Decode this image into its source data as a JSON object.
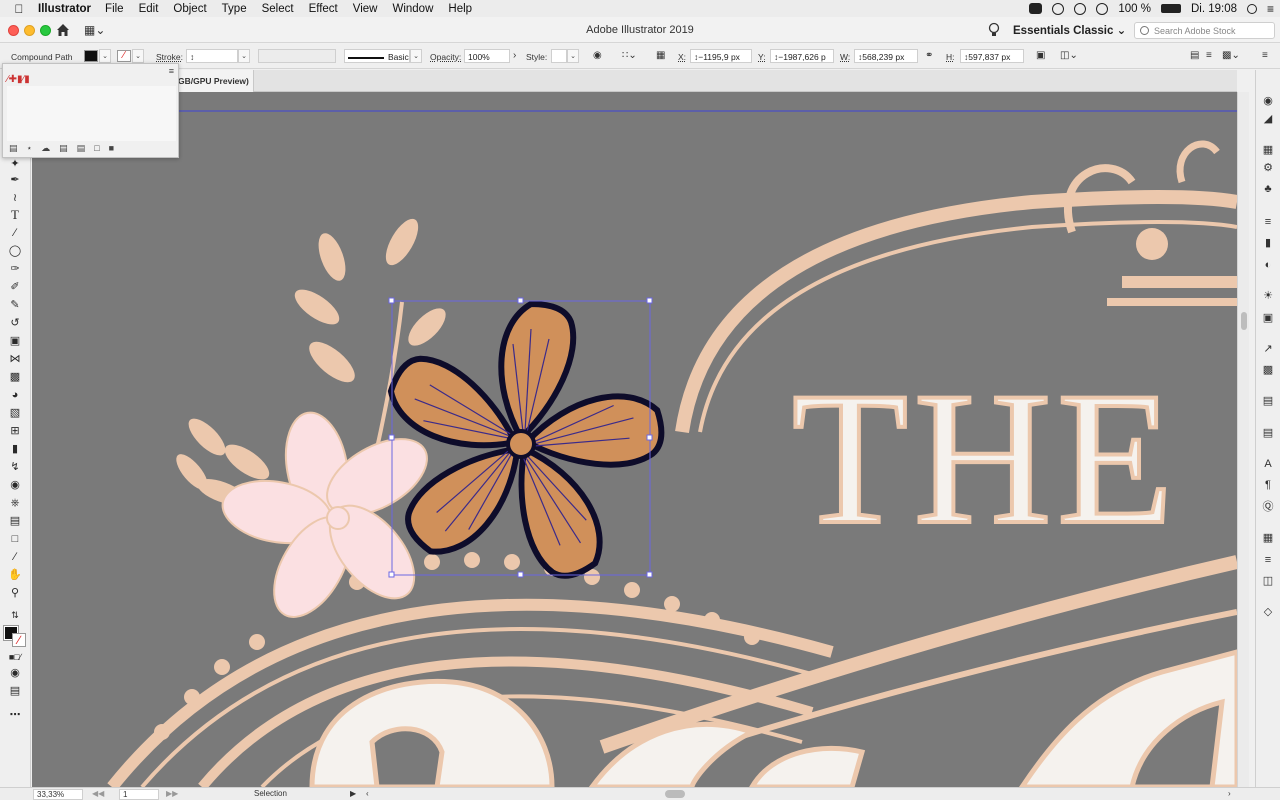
{
  "menubar": {
    "app_name": "Illustrator",
    "menus": [
      "File",
      "Edit",
      "Object",
      "Type",
      "Select",
      "Effect",
      "View",
      "Window",
      "Help"
    ],
    "battery": "100 %",
    "clock": "Di. 19:08"
  },
  "window": {
    "title": "Adobe Illustrator 2019",
    "workspace": "Essentials Classic",
    "search_placeholder": "Search Adobe Stock"
  },
  "control_bar": {
    "selection_type": "Compound Path",
    "stroke_label": "Stroke:",
    "brush_label": "Basic",
    "opacity_label": "Opacity:",
    "opacity_value": "100%",
    "style_label": "Style:",
    "x_label": "X:",
    "x_value": "−1195,9 px",
    "y_label": "Y:",
    "y_value": "−1987,626 p",
    "w_label": "W:",
    "w_value": "568,239 px",
    "h_label": "H:",
    "h_value": "597,837 px"
  },
  "document_tab": {
    "label": "GB/GPU Preview)"
  },
  "canvas": {
    "artboard_text": "THE",
    "colors": {
      "background": "#7a7a7a",
      "ornament": "#ecc8ad",
      "letter_fill": "#f5f2ee",
      "flower_fill": "#d0905a",
      "flower_outline": "#0e0c2a",
      "blossom": "#fbe0e2",
      "selection": "#6b67e3"
    }
  },
  "status_bar": {
    "zoom": "33,33%",
    "page": "1",
    "tool": "Selection"
  }
}
